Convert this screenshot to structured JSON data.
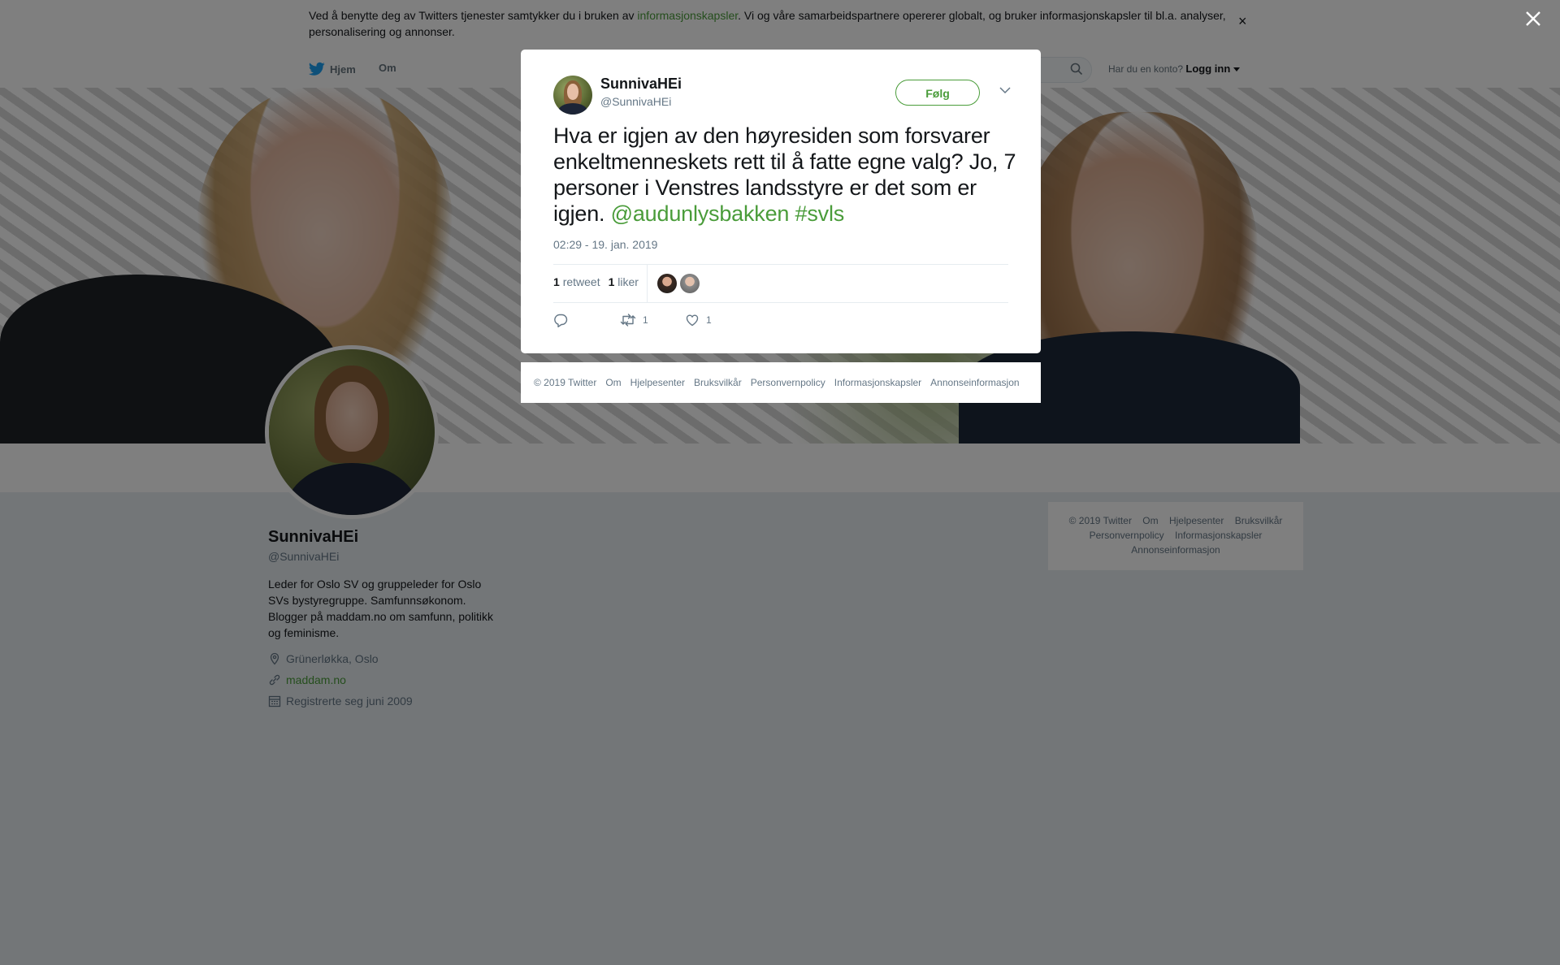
{
  "cookie_banner": {
    "text_before": "Ved å benytte deg av Twitters tjenester samtykker du i bruken av ",
    "link": "informasjonskapsler",
    "text_after": ". Vi og våre samarbeidspartnere opererer globalt, og bruker informasjonskapsler til bl.a. analyser, personalisering og annonser.",
    "close": "×"
  },
  "topnav": {
    "home": "Hjem",
    "about": "Om",
    "login_prompt": "Har du en konto?",
    "login": "Logg inn"
  },
  "profile": {
    "name": "SunnivaHEi",
    "handle": "@SunnivaHEi",
    "bio": "Leder for Oslo SV og gruppeleder for Oslo SVs bystyregruppe. Samfunnsøkonom. Blogger på maddam.no om samfunn, politikk og feminisme.",
    "location": "Grünerløkka, Oslo",
    "url": "maddam.no",
    "joined": "Registrerte seg juni 2009"
  },
  "side_footer": {
    "links": [
      "© 2019 Twitter",
      "Om",
      "Hjelpesenter",
      "Bruksvilkår",
      "Personvernpolicy",
      "Informasjonskapsler",
      "Annonseinformasjon"
    ]
  },
  "tweet": {
    "author_name": "SunnivaHEi",
    "author_handle": "@SunnivaHEi",
    "follow_label": "Følg",
    "text": "Hva er igjen av den høyresiden som forsvarer enkeltmenneskets rett til å fatte egne valg? Jo, 7 personer i Venstres landsstyre er det som er igjen. ",
    "mention": "@audunlysbakken",
    "hashtag": "#svls",
    "timestamp": "02:29 - 19. jan. 2019",
    "retweet_count": "1",
    "retweet_label": "retweet",
    "like_count": "1",
    "like_label": "liker",
    "action_retweets": "1",
    "action_likes": "1"
  },
  "modal_footer": {
    "links": [
      "© 2019 Twitter",
      "Om",
      "Hjelpesenter",
      "Bruksvilkår",
      "Personvernpolicy",
      "Informasjonskapsler",
      "Annonseinformasjon"
    ]
  },
  "colors": {
    "accent": "#4a9c3a",
    "overlay": "rgba(0,0,0,0.5)",
    "muted_text": "#657786"
  },
  "icons": [
    "twitter-bird-icon",
    "search-icon",
    "caret-down-icon",
    "location-icon",
    "link-icon",
    "calendar-icon",
    "reply-icon",
    "retweet-icon",
    "heart-icon",
    "close-icon",
    "chevron-down-icon"
  ]
}
